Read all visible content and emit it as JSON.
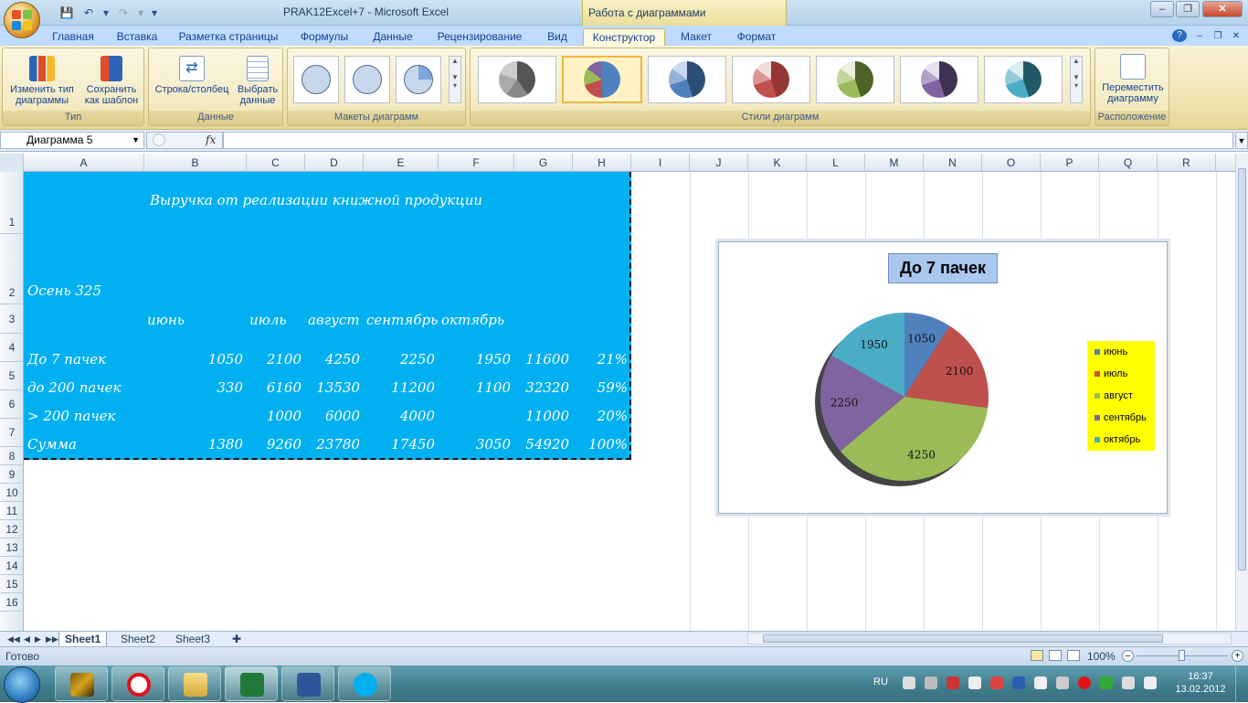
{
  "window": {
    "title": "PRAK12Excel+7 - Microsoft Excel",
    "context_title": "Работа с диаграммами"
  },
  "tabs": [
    "Главная",
    "Вставка",
    "Разметка страницы",
    "Формулы",
    "Данные",
    "Рецензирование",
    "Вид",
    "Конструктор",
    "Макет",
    "Формат"
  ],
  "active_tab": "Конструктор",
  "ribbon": {
    "groups": {
      "type": "Тип",
      "data": "Данные",
      "layouts": "Макеты диаграмм",
      "styles": "Стили диаграмм",
      "location": "Расположение"
    },
    "buttons": {
      "change_type": "Изменить тип диаграммы",
      "save_template": "Сохранить как шаблон",
      "row_col": "Строка/столбец",
      "select_data": "Выбрать данные",
      "move_chart": "Переместить диаграмму"
    },
    "style_colors": [
      "#555555",
      "#4f81bd",
      "#4f81bd",
      "#c0504d",
      "#9bbb59",
      "#8064a2",
      "#4bacc6"
    ]
  },
  "formula_bar": {
    "name_box": "Диаграмма 5",
    "fx": "fx",
    "value": ""
  },
  "columns": [
    "A",
    "B",
    "C",
    "D",
    "E",
    "F",
    "G",
    "H",
    "I",
    "J",
    "K",
    "L",
    "M",
    "N",
    "O",
    "P",
    "Q",
    "R"
  ],
  "rows": [
    "1",
    "2",
    "3",
    "4",
    "5",
    "6",
    "7",
    "8",
    "9",
    "10",
    "11",
    "12",
    "13",
    "14",
    "15",
    "16"
  ],
  "sheet": {
    "title": "Выручка от реализации книжной продукции",
    "subtitle": "Осень 325",
    "months": [
      "июнь",
      "июль",
      "август",
      "сентябрь",
      "октябрь"
    ],
    "table": [
      {
        "label": "До 7 пачек",
        "b": "1050",
        "c": "2100",
        "d": "4250",
        "e": "2250",
        "f": "1950",
        "g": "11600",
        "h": "21%"
      },
      {
        "label": "до 200 пачек",
        "b": "330",
        "c": "6160",
        "d": "13530",
        "e": "11200",
        "f": "1100",
        "g": "32320",
        "h": "59%"
      },
      {
        "label": "> 200 пачек",
        "b": "",
        "c": "1000",
        "d": "6000",
        "e": "4000",
        "f": "",
        "g": "11000",
        "h": "20%"
      },
      {
        "label": "Сумма",
        "b": "1380",
        "c": "9260",
        "d": "23780",
        "e": "17450",
        "f": "3050",
        "g": "54920",
        "h": "100%"
      }
    ]
  },
  "chart_data": {
    "type": "pie",
    "title": "До 7 пачек",
    "categories": [
      "июнь",
      "июль",
      "август",
      "сентябрь",
      "октябрь"
    ],
    "values": [
      1050,
      2100,
      4250,
      2250,
      1950
    ],
    "colors": [
      "#4f81bd",
      "#c0504d",
      "#9bbb59",
      "#8064a2",
      "#4bacc6"
    ],
    "legend": "right"
  },
  "sheet_tabs": [
    "Sheet1",
    "Sheet2",
    "Sheet3"
  ],
  "status": {
    "ready": "Готово",
    "zoom": "100%"
  },
  "taskbar": {
    "lang": "RU",
    "time": "16:37",
    "date": "13.02.2012"
  }
}
